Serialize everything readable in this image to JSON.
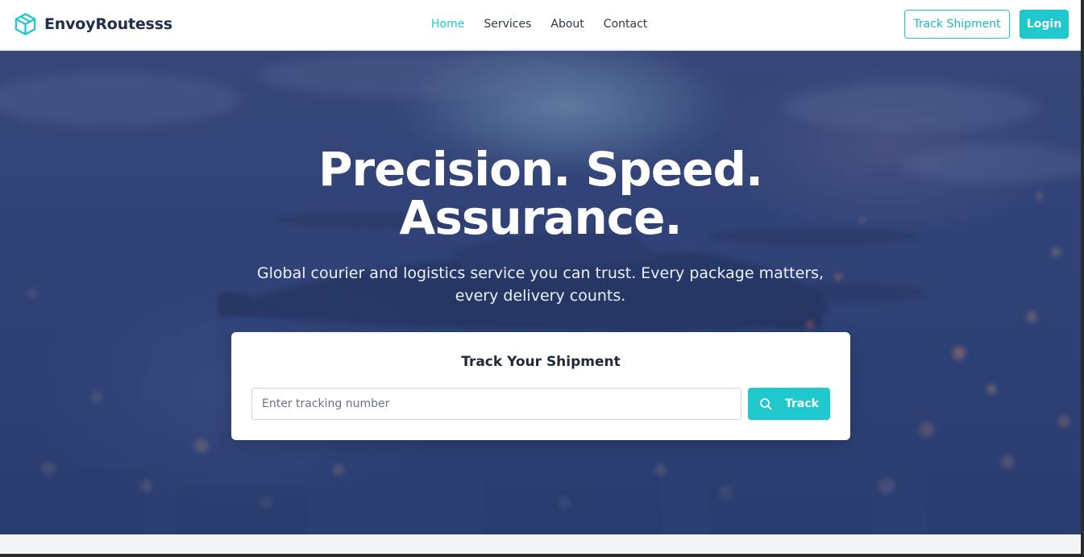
{
  "brand": {
    "name": "EnvoyRoutesss",
    "icon": "package-box-icon"
  },
  "nav": {
    "links": [
      {
        "label": "Home",
        "active": true
      },
      {
        "label": "Services",
        "active": false
      },
      {
        "label": "About",
        "active": false
      },
      {
        "label": "Contact",
        "active": false
      }
    ],
    "track_shipment_label": "Track Shipment",
    "login_label": "Login"
  },
  "hero": {
    "title_line1": "Precision. Speed.",
    "title_line2": "Assurance.",
    "subtitle": "Global courier and logistics service you can trust. Every package matters, every delivery counts."
  },
  "tracker": {
    "title": "Track Your Shipment",
    "input_placeholder": "Enter tracking number",
    "input_value": "",
    "button_label": "Track",
    "button_icon": "search-icon"
  },
  "colors": {
    "accent": "#1ec8cc",
    "brand_text": "#1f2d4d",
    "hero_overlay": "#2f4377"
  }
}
